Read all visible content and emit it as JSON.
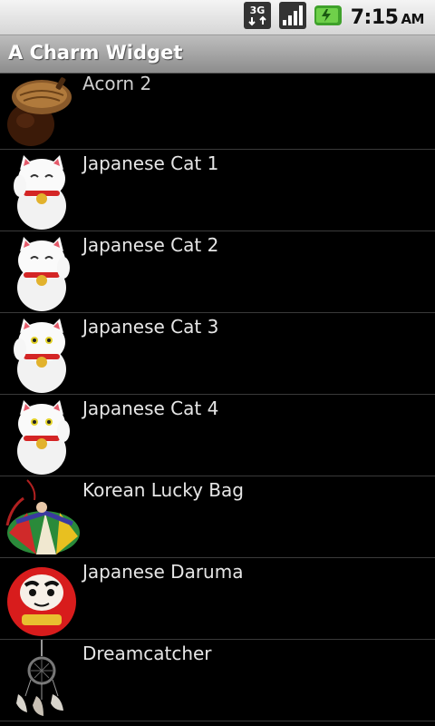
{
  "status_bar": {
    "network": "3G",
    "time": "7:15",
    "ampm": "AM",
    "icons": [
      "network-3g-icon",
      "signal-icon",
      "battery-charging-icon"
    ]
  },
  "title_bar": {
    "title": "A Charm Widget"
  },
  "charms": [
    {
      "label": "Acorn 2",
      "icon": "acorn-icon"
    },
    {
      "label": "Japanese Cat 1",
      "icon": "lucky-cat-icon"
    },
    {
      "label": "Japanese Cat 2",
      "icon": "lucky-cat-icon"
    },
    {
      "label": "Japanese Cat 3",
      "icon": "lucky-cat-icon"
    },
    {
      "label": "Japanese Cat 4",
      "icon": "lucky-cat-icon"
    },
    {
      "label": "Korean Lucky Bag",
      "icon": "lucky-bag-icon"
    },
    {
      "label": "Japanese Daruma",
      "icon": "daruma-icon"
    },
    {
      "label": "Dreamcatcher",
      "icon": "dreamcatcher-icon"
    }
  ],
  "colors": {
    "background": "#000000",
    "text": "#e6e6e6",
    "divider": "#3a3a3a",
    "title_text": "#ffffff"
  }
}
